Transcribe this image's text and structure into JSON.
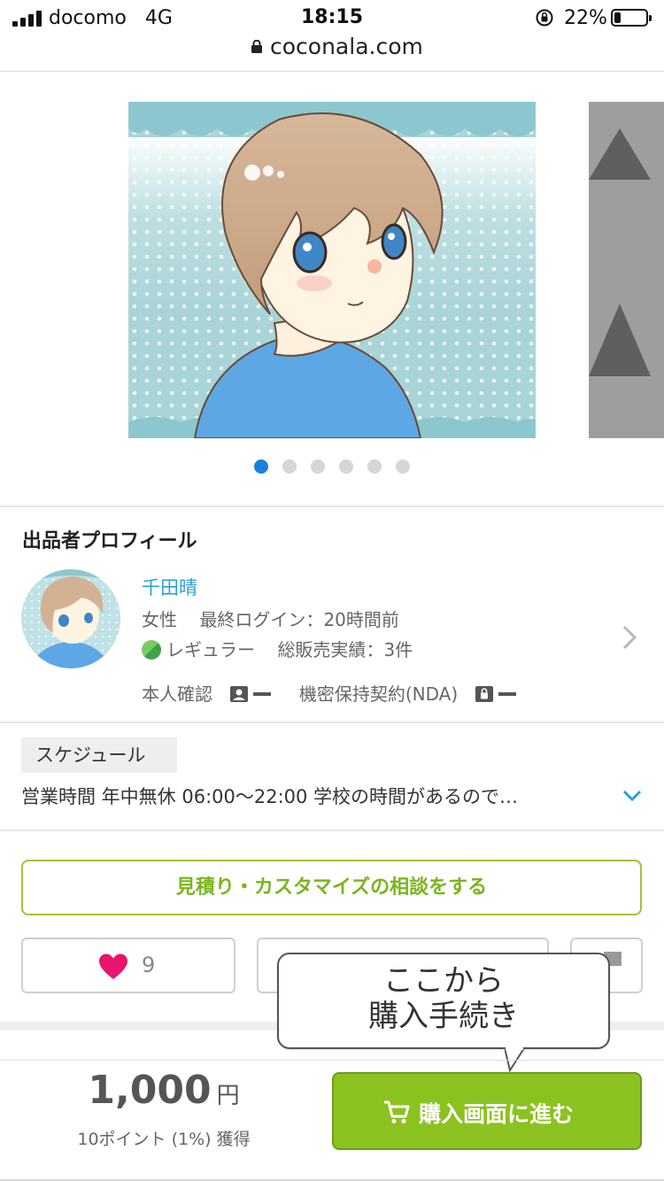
{
  "status_bar": {
    "carrier": "docomo",
    "network": "4G",
    "time": "18:15",
    "battery": "22%",
    "battery_level": 0.22
  },
  "browser": {
    "url": "coconala.com"
  },
  "carousel": {
    "slide_count": 6,
    "active_index": 0
  },
  "profile": {
    "section_title": "出品者プロフィール",
    "seller_name": "千田晴",
    "gender": "女性",
    "last_login_label": "最終ログイン：",
    "last_login_value": "20時間前",
    "rank": "レギュラー",
    "sales_label": "総販売実績：",
    "sales_value": "3件",
    "identity_label": "本人確認",
    "nda_label": "機密保持契約(NDA)"
  },
  "schedule": {
    "label": "スケジュール",
    "text": "営業時間 年中無休 06:00〜22:00 学校の時間があるので…"
  },
  "actions": {
    "consult_label": "見積り・カスタマイズの相談をする",
    "favorite_count": "9"
  },
  "callout": {
    "line1": "ここから",
    "line2": "購入手続き"
  },
  "purchase": {
    "price": "1,000",
    "currency": "円",
    "points_text": "10ポイント (1%) 獲得",
    "buy_label": "購入画面に進む"
  },
  "colors": {
    "link_blue": "#2a9fd6",
    "accent_green": "#8cc220",
    "heart": "#e8146e",
    "active_dot": "#1b7fe0"
  }
}
